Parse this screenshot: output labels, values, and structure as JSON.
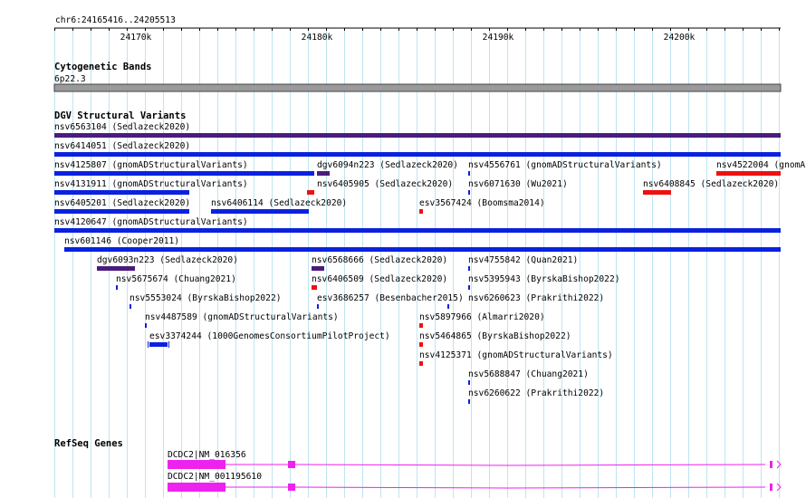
{
  "ruler": {
    "region": "chr6:24165416..24205513",
    "ticks": [
      "24170k",
      "24180k",
      "24190k",
      "24200k"
    ]
  },
  "cytoband": {
    "title": "Cytogenetic Bands",
    "band": "6p22.3"
  },
  "dgv": {
    "title": "DGV Structural Variants",
    "features": [
      {
        "id": "nsv6563104",
        "label": "nsv6563104 (Sedlazeck2020)",
        "color": "#4b1c7e"
      },
      {
        "id": "nsv6414051",
        "label": "nsv6414051 (Sedlazeck2020)",
        "color": "#0a21e0"
      },
      {
        "id": "nsv4125807",
        "label": "nsv4125807 (gnomADStructuralVariants)",
        "color": "#0a21e0"
      },
      {
        "id": "dgv6094n223",
        "label": "dgv6094n223 (Sedlazeck2020)",
        "color": "#4b1c7e"
      },
      {
        "id": "nsv4556761",
        "label": "nsv4556761 (gnomADStructuralVariants)",
        "color": "#0a21e0"
      },
      {
        "id": "nsv4522004",
        "label": "nsv4522004 (gnomA",
        "color": "#ee1111"
      },
      {
        "id": "nsv4131911",
        "label": "nsv4131911 (gnomADStructuralVariants)",
        "color": "#0a21e0"
      },
      {
        "id": "nsv6405905",
        "label": "nsv6405905 (Sedlazeck2020)",
        "color": "#ee1111"
      },
      {
        "id": "nsv6071630",
        "label": "nsv6071630 (Wu2021)",
        "color": "#0a21e0"
      },
      {
        "id": "nsv6408845",
        "label": "nsv6408845 (Sedlazeck2020)",
        "color": "#ee1111"
      },
      {
        "id": "nsv6405201",
        "label": "nsv6405201 (Sedlazeck2020)",
        "color": "#0a21e0"
      },
      {
        "id": "nsv6406114",
        "label": "nsv6406114 (Sedlazeck2020)",
        "color": "#0a21e0"
      },
      {
        "id": "esv3567424",
        "label": "esv3567424 (Boomsma2014)",
        "color": "#ee1111"
      },
      {
        "id": "nsv4120647",
        "label": "nsv4120647 (gnomADStructuralVariants)",
        "color": "#0a21e0"
      },
      {
        "id": "nsv601146",
        "label": "nsv601146 (Cooper2011)",
        "color": "#0a21e0"
      },
      {
        "id": "dgv6093n223",
        "label": "dgv6093n223 (Sedlazeck2020)",
        "color": "#4b1c7e"
      },
      {
        "id": "nsv6568666",
        "label": "nsv6568666 (Sedlazeck2020)",
        "color": "#4b1c7e"
      },
      {
        "id": "nsv4755842",
        "label": "nsv4755842 (Quan2021)",
        "color": "#0a21e0"
      },
      {
        "id": "nsv5675674",
        "label": "nsv5675674 (Chuang2021)",
        "color": "#0a21e0"
      },
      {
        "id": "nsv6406509",
        "label": "nsv6406509 (Sedlazeck2020)",
        "color": "#ee1111"
      },
      {
        "id": "nsv5395943",
        "label": "nsv5395943 (ByrskaBishop2022)",
        "color": "#0a21e0"
      },
      {
        "id": "nsv5553024",
        "label": "nsv5553024 (ByrskaBishop2022)",
        "color": "#0a21e0"
      },
      {
        "id": "esv3686257",
        "label": "esv3686257 (Besenbacher2015)",
        "color": "#0a21e0"
      },
      {
        "id": "nsv6260623",
        "label": "nsv6260623 (Prakrithi2022)",
        "color": "#0a21e0"
      },
      {
        "id": "nsv4487589",
        "label": "nsv4487589 (gnomADStructuralVariants)",
        "color": "#0a21e0"
      },
      {
        "id": "nsv5897966",
        "label": "nsv5897966 (Almarri2020)",
        "color": "#ee1111"
      },
      {
        "id": "esv3374244",
        "label": "esv3374244 (1000GenomesConsortiumPilotProject)",
        "color": "#0a21e0"
      },
      {
        "id": "nsv5464865",
        "label": "nsv5464865 (ByrskaBishop2022)",
        "color": "#ee1111"
      },
      {
        "id": "nsv4125371",
        "label": "nsv4125371 (gnomADStructuralVariants)",
        "color": "#ee1111"
      },
      {
        "id": "nsv5688847",
        "label": "nsv5688847 (Chuang2021)",
        "color": "#0a21e0"
      },
      {
        "id": "nsv6260622",
        "label": "nsv6260622 (Prakrithi2022)",
        "color": "#0a21e0"
      }
    ]
  },
  "refseq": {
    "title": "RefSeq Genes",
    "color": "#ee22ee",
    "transcripts": [
      {
        "label": "DCDC2|NM_016356"
      },
      {
        "label": "DCDC2|NM_001195610"
      }
    ]
  }
}
